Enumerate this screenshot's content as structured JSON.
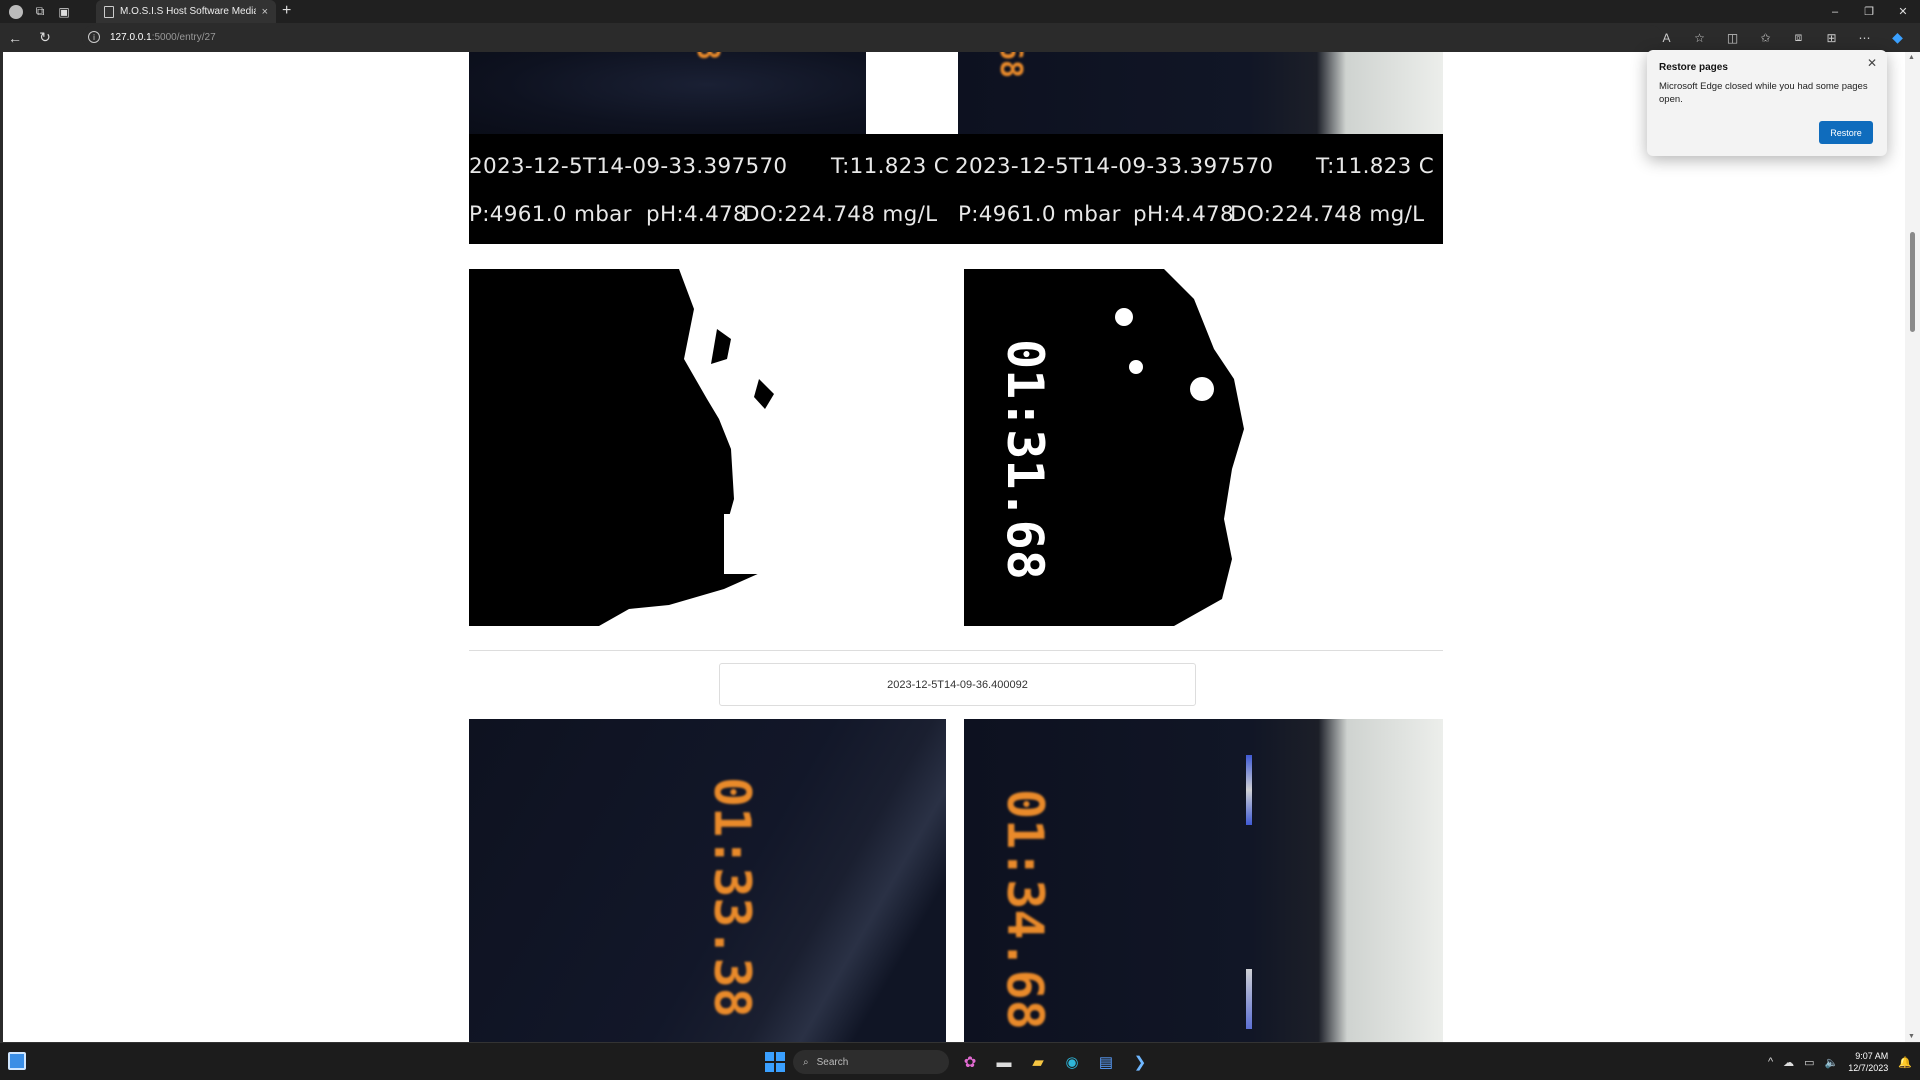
{
  "browser": {
    "tab_title": "M.O.S.I.S Host Software Media E",
    "tab_close": "×",
    "new_tab": "+",
    "url_host": "127.0.0.1",
    "url_path": ":5000/entry/27",
    "window_controls": {
      "minimize": "–",
      "restore": "❐",
      "close": "✕"
    }
  },
  "entry_prev": {
    "left": {
      "timestamp": "2023-12-5T14-09-33.397570",
      "temperature": "T:11.823 C",
      "pressure": "P:4961.0 mbar",
      "ph": "pH:4.478",
      "do": "DO:224.748 mg/L"
    },
    "right": {
      "timestamp": "2023-12-5T14-09-33.397570",
      "temperature": "T:11.823 C",
      "pressure": "P:4961.0 mbar",
      "ph": "pH:4.478",
      "do": "DO:224.748 mg/L"
    },
    "top_crop_left_digits": "8",
    "top_crop_right_digits": "68",
    "bw_right_digits": "01:31.68"
  },
  "entry_next": {
    "timestamp_label": "2023-12-5T14-09-36.400092",
    "left_digits": "01:33.38",
    "right_digits": "01:34.68"
  },
  "toast": {
    "title": "Restore pages",
    "body": "Microsoft Edge closed while you had some pages open.",
    "button": "Restore",
    "close": "✕"
  },
  "taskbar": {
    "search_placeholder": "Search",
    "clock_time": "9:07 AM",
    "clock_date": "12/7/2023"
  },
  "colors": {
    "accent": "#0f6cbd",
    "digit_orange": "#e98a2a"
  }
}
